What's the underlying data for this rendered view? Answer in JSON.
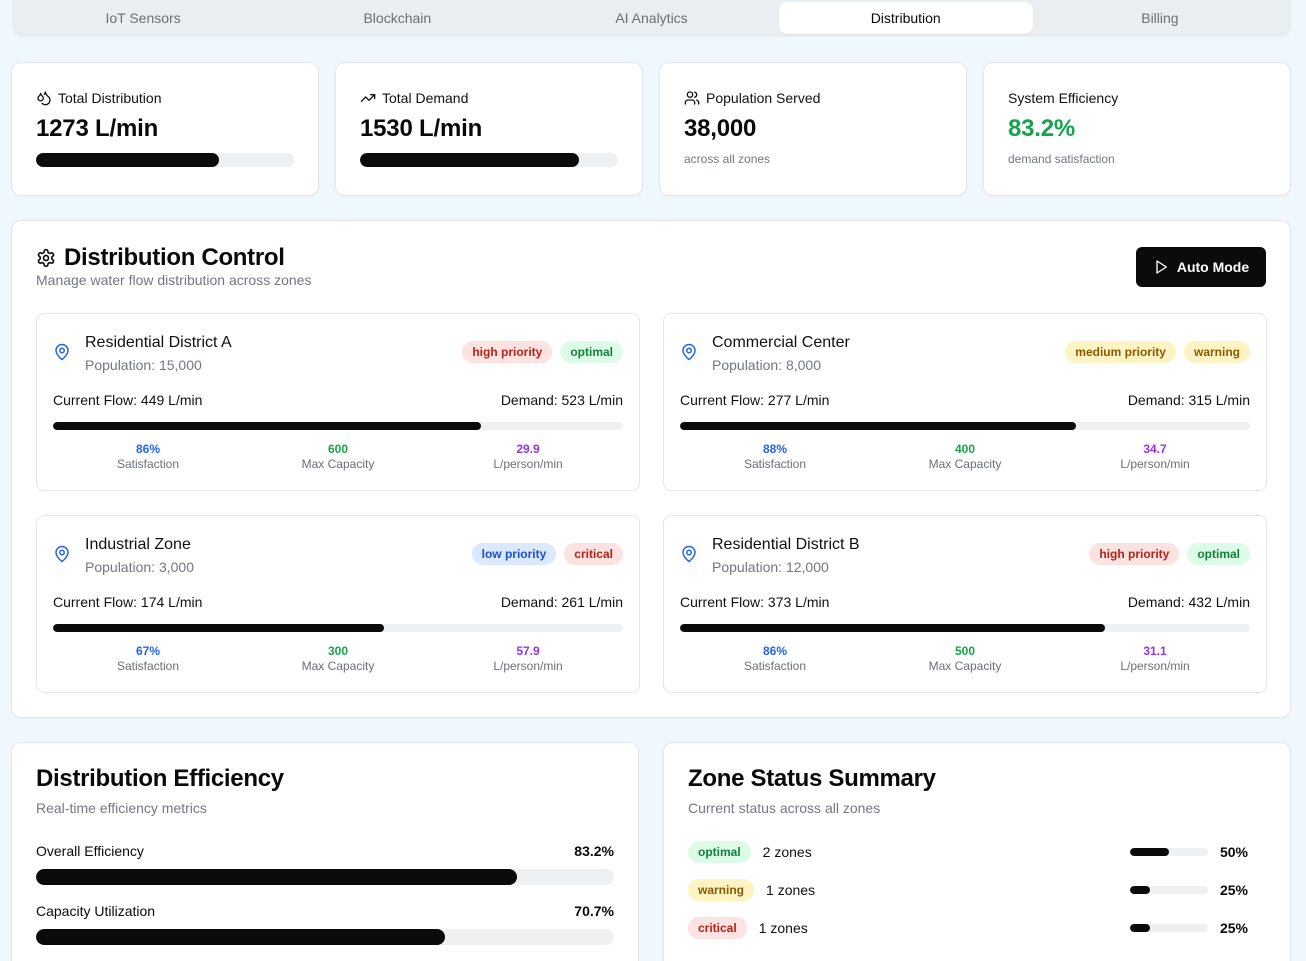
{
  "tabs": [
    {
      "label": "IoT Sensors",
      "active": false
    },
    {
      "label": "Blockchain",
      "active": false
    },
    {
      "label": "AI Analytics",
      "active": false
    },
    {
      "label": "Distribution",
      "active": true
    },
    {
      "label": "Billing",
      "active": false
    }
  ],
  "stats": {
    "total_distribution": {
      "label": "Total Distribution",
      "value": "1273 L/min",
      "progress": 0.71,
      "icon": "droplets-icon"
    },
    "total_demand": {
      "label": "Total Demand",
      "value": "1530 L/min",
      "progress": 0.85,
      "icon": "trending-up-icon"
    },
    "population": {
      "label": "Population Served",
      "value": "38,000",
      "sub": "across all zones",
      "icon": "users-icon"
    },
    "efficiency": {
      "label": "System Efficiency",
      "value": "83.2%",
      "sub": "demand satisfaction",
      "color": "#16a34a"
    }
  },
  "control": {
    "title": "Distribution Control",
    "description": "Manage water flow distribution across zones",
    "auto_button": "Auto Mode",
    "zones": [
      {
        "name": "Residential District A",
        "population": "Population: 15,000",
        "priority": "high priority",
        "priority_class": "b-high",
        "status": "optimal",
        "status_class": "b-optimal",
        "flow": "Current Flow: 449 L/min",
        "demand": "Demand: 523 L/min",
        "fill": 0.75,
        "satisfaction": "86%",
        "max_capacity": "600",
        "per_person": "29.9"
      },
      {
        "name": "Commercial Center",
        "population": "Population: 8,000",
        "priority": "medium priority",
        "priority_class": "b-medium",
        "status": "warning",
        "status_class": "b-warning",
        "flow": "Current Flow: 277 L/min",
        "demand": "Demand: 315 L/min",
        "fill": 0.695,
        "satisfaction": "88%",
        "max_capacity": "400",
        "per_person": "34.7"
      },
      {
        "name": "Industrial Zone",
        "population": "Population: 3,000",
        "priority": "low priority",
        "priority_class": "b-low",
        "status": "critical",
        "status_class": "b-critical",
        "flow": "Current Flow: 174 L/min",
        "demand": "Demand: 261 L/min",
        "fill": 0.58,
        "satisfaction": "67%",
        "max_capacity": "300",
        "per_person": "57.9"
      },
      {
        "name": "Residential District B",
        "population": "Population: 12,000",
        "priority": "high priority",
        "priority_class": "b-high",
        "status": "optimal",
        "status_class": "b-optimal",
        "flow": "Current Flow: 373 L/min",
        "demand": "Demand: 432 L/min",
        "fill": 0.745,
        "satisfaction": "86%",
        "max_capacity": "500",
        "per_person": "31.1"
      }
    ],
    "metric_labels": {
      "satisfaction": "Satisfaction",
      "max_capacity": "Max Capacity",
      "per_person": "L/person/min"
    }
  },
  "efficiency": {
    "title": "Distribution Efficiency",
    "description": "Real-time efficiency metrics",
    "rows": [
      {
        "label": "Overall Efficiency",
        "value": "83.2%",
        "fill": 0.832
      },
      {
        "label": "Capacity Utilization",
        "value": "70.7%",
        "fill": 0.707
      }
    ]
  },
  "summary": {
    "title": "Zone Status Summary",
    "description": "Current status across all zones",
    "rows": [
      {
        "status": "optimal",
        "class": "b-optimal",
        "count": "2 zones",
        "pct": "50%",
        "fill": 0.5
      },
      {
        "status": "warning",
        "class": "b-warning",
        "count": "1 zones",
        "pct": "25%",
        "fill": 0.25
      },
      {
        "status": "critical",
        "class": "b-critical",
        "count": "1 zones",
        "pct": "25%",
        "fill": 0.25
      }
    ]
  }
}
